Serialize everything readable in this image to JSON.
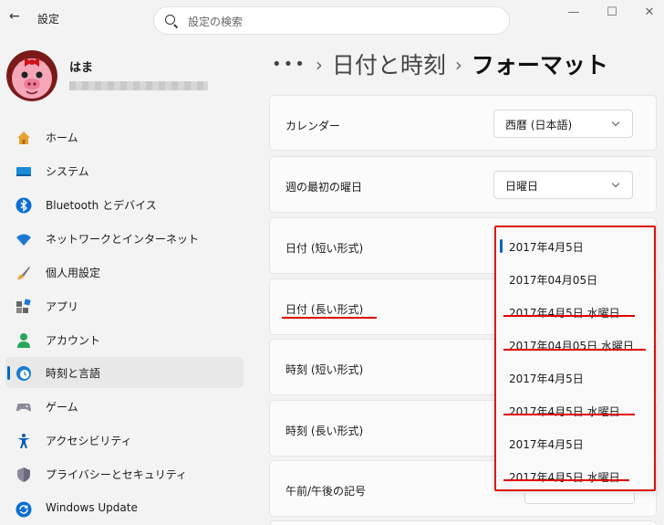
{
  "titlebar": {
    "app_title": "設定",
    "search_placeholder": "設定の検索"
  },
  "profile": {
    "name": "はま"
  },
  "nav": [
    {
      "label": "ホーム",
      "icon": "home-icon"
    },
    {
      "label": "システム",
      "icon": "system-icon"
    },
    {
      "label": "Bluetooth とデバイス",
      "icon": "bluetooth-icon"
    },
    {
      "label": "ネットワークとインターネット",
      "icon": "wifi-icon"
    },
    {
      "label": "個人用設定",
      "icon": "brush-icon"
    },
    {
      "label": "アプリ",
      "icon": "apps-icon"
    },
    {
      "label": "アカウント",
      "icon": "account-icon"
    },
    {
      "label": "時刻と言語",
      "icon": "clock-globe-icon",
      "selected": true
    },
    {
      "label": "ゲーム",
      "icon": "gamepad-icon"
    },
    {
      "label": "アクセシビリティ",
      "icon": "accessibility-icon"
    },
    {
      "label": "プライバシーとセキュリティ",
      "icon": "shield-icon"
    },
    {
      "label": "Windows Update",
      "icon": "update-icon"
    }
  ],
  "breadcrumb": {
    "dots": "•••",
    "parent": "日付と時刻",
    "current": "フォーマット"
  },
  "settings": {
    "calendar": {
      "label": "カレンダー",
      "value": "西暦 (日本語)"
    },
    "first_day": {
      "label": "週の最初の曜日",
      "value": "日曜日"
    },
    "short_date": {
      "label": "日付 (短い形式)"
    },
    "long_date": {
      "label": "日付 (長い形式)"
    },
    "short_time": {
      "label": "時刻 (短い形式)"
    },
    "long_time": {
      "label": "時刻 (長い形式)"
    },
    "ampm": {
      "label": "午前/午後の記号"
    }
  },
  "popup_options": [
    "2017年4月5日",
    "2017年04月05日",
    "2017年4月5日 水曜日",
    "2017年04月05日 水曜日",
    "2017年4月5日",
    "2017年4月5日 水曜日",
    "2017年4月5日",
    "2017年4月5日 水曜日"
  ],
  "colors": {
    "accent": "#0067c0",
    "annotation_red": "#e00000"
  }
}
